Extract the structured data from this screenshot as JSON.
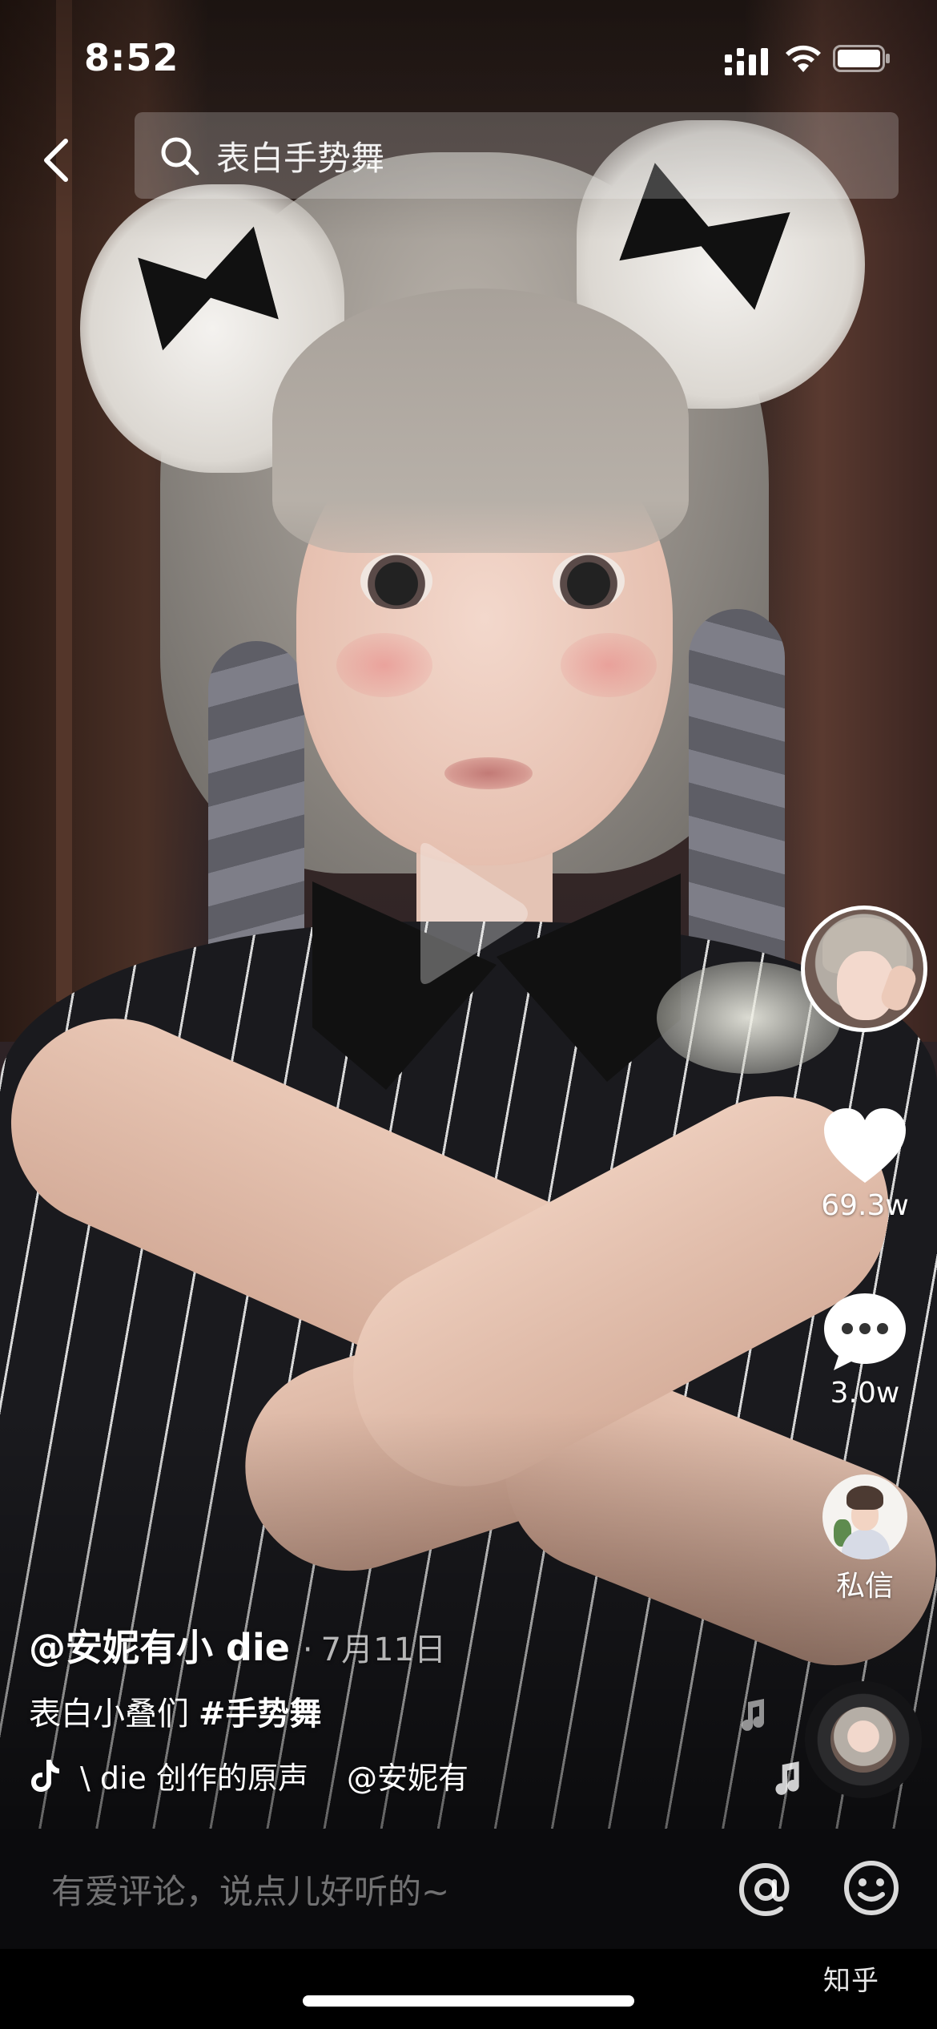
{
  "status_bar": {
    "time": "8:52",
    "signal_icon": "cellular-signal-icon",
    "wifi_icon": "wifi-icon",
    "battery_icon": "battery-icon"
  },
  "header": {
    "back_icon": "chevron-left-icon",
    "search": {
      "icon": "search-icon",
      "query": "表白手势舞"
    }
  },
  "video": {
    "play_icon": "play-icon"
  },
  "right_rail": {
    "avatar_icon": "author-avatar",
    "like": {
      "icon": "heart-icon",
      "count": "69.3w"
    },
    "comment": {
      "icon": "comment-bubble-icon",
      "count": "3.0w"
    },
    "direct_message": {
      "icon": "dm-avatar",
      "label": "私信"
    }
  },
  "caption": {
    "author": "@安妮有小 die",
    "date": "7月11日",
    "description": "表白小叠们",
    "hashtag": "#手势舞",
    "music": {
      "icon": "tiktok-note-icon",
      "track_parts": [
        "\\ die 创作的原声",
        "@安妮有"
      ]
    }
  },
  "comment_bar": {
    "placeholder": "有爱评论，说点儿好听的~",
    "at_icon": "at-icon",
    "emoji_icon": "emoji-icon"
  },
  "watermark": "知乎"
}
